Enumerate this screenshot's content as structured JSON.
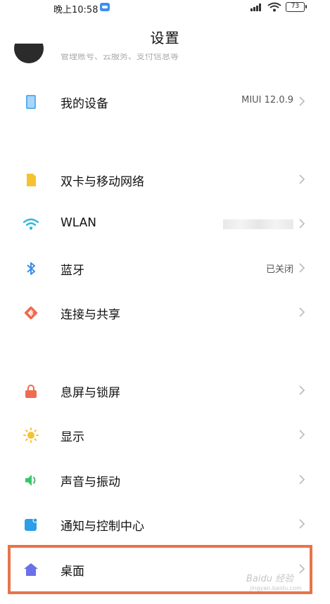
{
  "status_bar": {
    "time": "晚上10:58",
    "battery": "73"
  },
  "header": {
    "title": "设置"
  },
  "account": {
    "subtitle": "管理账号、云服务、支付信息等"
  },
  "rows": {
    "my_device": {
      "label": "我的设备",
      "value": "MIUI 12.0.9"
    },
    "sim": {
      "label": "双卡与移动网络"
    },
    "wlan": {
      "label": "WLAN"
    },
    "bluetooth": {
      "label": "蓝牙",
      "value": "已关闭"
    },
    "connection": {
      "label": "连接与共享"
    },
    "lockscreen": {
      "label": "息屏与锁屏"
    },
    "display": {
      "label": "显示"
    },
    "sound": {
      "label": "声音与振动"
    },
    "notification": {
      "label": "通知与控制中心"
    },
    "desktop": {
      "label": "桌面"
    }
  },
  "watermark": {
    "text": "Baidu 经验",
    "sub": "jingyan.baidu.com"
  },
  "colors": {
    "highlight": "#e8734a",
    "accent_blue": "#3b8ff0"
  }
}
